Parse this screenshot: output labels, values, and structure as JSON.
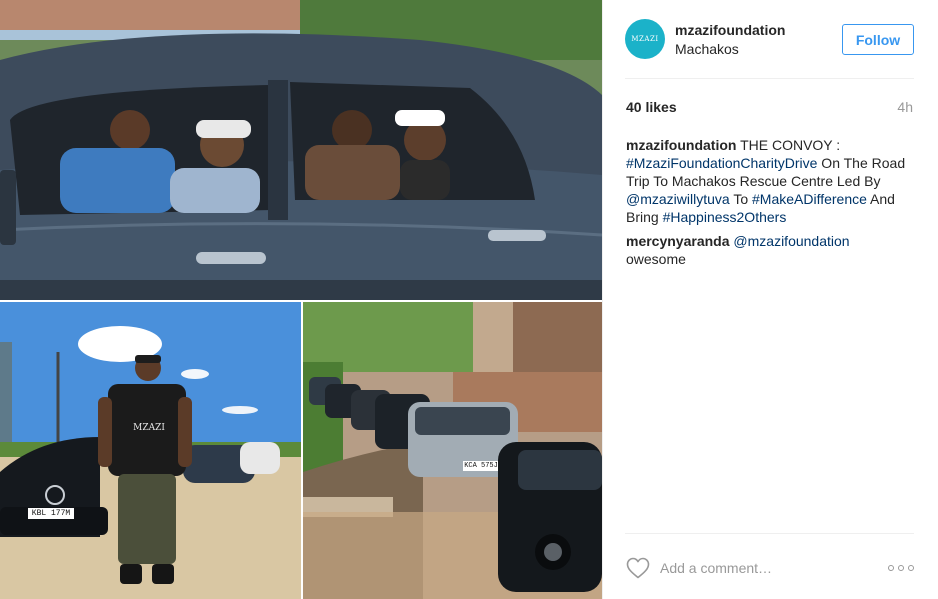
{
  "post": {
    "username": "mzazifoundation",
    "location": "Machakos",
    "follow_label": "Follow",
    "avatar_text": "MZAZI",
    "likes": "40 likes",
    "time_ago": "4h",
    "caption": {
      "user": "mzazifoundation",
      "t1": " THE CONVOY : ",
      "tag1": "#MzaziFoundationCharityDrive",
      "t2": " On The Road Trip To Machakos Rescue Centre Led By ",
      "mention1": "@mzaziwillytuva",
      "t3": " To ",
      "tag2": "#MakeADifference",
      "t4": " And Bring ",
      "tag3": "#Happiness2Others"
    },
    "comment": {
      "user": "mercynyaranda",
      "mention": "@mzazifoundation",
      "text": "owesome"
    },
    "add_comment_placeholder": "Add a comment…"
  },
  "photo": {
    "shirt_text": "MZAZI",
    "plate_left": "KBL 177M",
    "plate_right": "KCA 575J"
  },
  "colors": {
    "accent": "#3897f0",
    "link": "#003569",
    "muted": "#999999",
    "avatar_bg": "#1bb2c9"
  }
}
